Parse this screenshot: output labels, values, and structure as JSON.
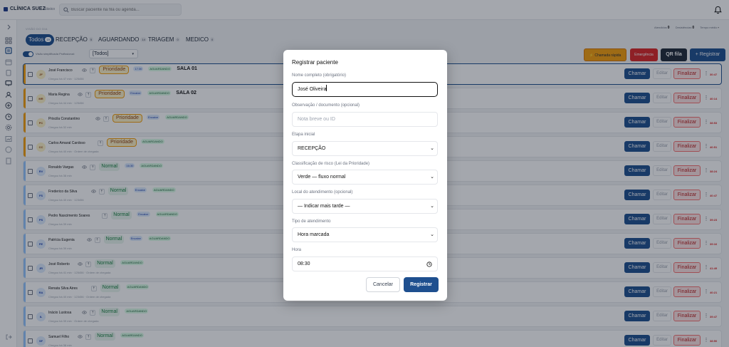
{
  "header": {
    "brand": "CLÍNICA SUEZ",
    "plan": "Básico",
    "search_placeholder": "Buscar paciente na fila ou agenda..."
  },
  "page": {
    "overline": "VISÃO DO DIA",
    "counters": [
      {
        "label": "Atendidos",
        "value": "0"
      },
      {
        "label": "Desistências",
        "value": "0"
      },
      {
        "label": "Tempo médio",
        "value": "-"
      }
    ],
    "tabs": [
      {
        "label": "Todos",
        "count": "19",
        "active": true
      },
      {
        "label": "RECEPÇÃO",
        "count": "5"
      },
      {
        "label": "AGUARDANDO",
        "count": "14"
      },
      {
        "label": "TRIAGEM",
        "count": "0"
      },
      {
        "label": "MEDICO",
        "count": "0"
      }
    ],
    "toggle_label": "Visão simplificada",
    "professional_label": "Profissional:",
    "professional_value": "[Todos]",
    "toolbar": {
      "chamada_rapida": "Chamada rápida",
      "emergencia": "Emergência",
      "qr_fila": "QR fila",
      "registrar": "+ Registrar"
    }
  },
  "queue": {
    "rows": [
      {
        "initials": "JF",
        "name": "José Francisco",
        "triage": "Prioridade",
        "time": "17:30",
        "status": "AGUARDANDO",
        "room": "SALA 01",
        "sub": "Chegou há 47 min · 125456",
        "timer": "30:47",
        "chamar": "Chamar",
        "editar": "Editar",
        "finalizar": "Finalizar"
      },
      {
        "initials": "MR",
        "name": "Maria Regina",
        "triage": "Prioridade",
        "time": "Encaixe",
        "status": "AGUARDANDO",
        "room": "SALA 02",
        "sub": "Chegou há 44 min · 125456",
        "timer": "40:14",
        "chamar": "Chamar",
        "editar": "Editar",
        "finalizar": "Finalizar"
      },
      {
        "initials": "PC",
        "name": "Priscila Constantino",
        "triage": "Prioridade",
        "time": "Encaixe",
        "status": "AGUARDANDO",
        "room": "",
        "sub": "Chegou há 32 min",
        "timer": "38:53",
        "chamar": "Chamar",
        "editar": "Editar",
        "finalizar": "Finalizar"
      },
      {
        "initials": "CC",
        "name": "Carlos Amaral Cardoso",
        "triage": "Prioridade",
        "time": "",
        "status": "AGUARDANDO",
        "room": "",
        "sub": "Chegou há 40 min · Ordem de chegada",
        "timer": "40:51",
        "chamar": "Chamar",
        "editar": "Editar",
        "finalizar": "Finalizar"
      },
      {
        "initials": "RV",
        "name": "Ronaldo Vargas",
        "triage": "Normal",
        "time": "16:30",
        "status": "AGUARDANDO",
        "room": "",
        "sub": "Chegou há 38 min",
        "timer": "38:24",
        "chamar": "Chamar",
        "editar": "Editar",
        "finalizar": "Finalizar"
      },
      {
        "initials": "FS",
        "name": "Frederico da Silva",
        "triage": "Normal",
        "time": "Encaixe",
        "status": "AGUARDANDO",
        "room": "",
        "sub": "Chegou há 40 min · 123456",
        "timer": "40:47",
        "chamar": "Chamar",
        "editar": "Editar",
        "finalizar": "Finalizar"
      },
      {
        "initials": "PS",
        "name": "Pedro Nascimento Soares",
        "triage": "Normal",
        "time": "Encaixe",
        "status": "AGUARDANDO",
        "room": "",
        "sub": "Chegou há 39 min",
        "timer": "39:23",
        "chamar": "Chamar",
        "editar": "Editar",
        "finalizar": "Finalizar"
      },
      {
        "initials": "PE",
        "name": "Patrícia Eugenia",
        "triage": "Normal",
        "time": "Encaixe",
        "status": "AGUARDANDO",
        "room": "",
        "sub": "Chegou há 39 min",
        "timer": "39:16",
        "chamar": "Chamar",
        "editar": "Editar",
        "finalizar": "Finalizar"
      },
      {
        "initials": "JR",
        "name": "José Roberto",
        "triage": "Normal",
        "time": "",
        "status": "AGUARDANDO",
        "room": "",
        "sub": "Chegou há 41 min · 125456 · Ordem de chegada",
        "timer": "41:49",
        "chamar": "Chamar",
        "editar": "Editar",
        "finalizar": "Finalizar"
      },
      {
        "initials": "RA",
        "name": "Renata Silva Aires",
        "triage": "Normal",
        "time": "",
        "status": "AGUARDANDO",
        "room": "",
        "sub": "Chegou há 40 min · 123456 · Ordem de chegada",
        "timer": "40:21",
        "chamar": "Chamar",
        "editar": "Editar",
        "finalizar": "Finalizar"
      },
      {
        "initials": "IL",
        "name": "Inácio Lustosa",
        "triage": "Normal",
        "time": "",
        "status": "AGUARDANDO",
        "room": "",
        "sub": "Chegou há 39 min · Ordem de chegada",
        "timer": "39:47",
        "chamar": "Chamar",
        "editar": "Editar",
        "finalizar": "Finalizar"
      },
      {
        "initials": "SF",
        "name": "Samuel Filho",
        "triage": "Normal",
        "time": "",
        "status": "AGUARDANDO",
        "room": "",
        "sub": "Chegou há 38 min",
        "timer": "38:50",
        "chamar": "Chamar",
        "editar": "Editar",
        "finalizar": "Finalizar"
      }
    ]
  },
  "modal": {
    "title": "Registrar paciente",
    "name_label": "Nome completo (obrigatório)",
    "name_value": "José Oliveira",
    "obs_label": "Observação / documento (opcional)",
    "obs_placeholder": "Nota breve ou ID",
    "stage_label": "Etapa inicial",
    "stage_value": "RECEPÇÃO",
    "risk_label": "Classificação de risco (Lei da Prioridade)",
    "risk_value": "Verde — fluxo normal",
    "location_label": "Local do atendimento (opcional)",
    "location_value": "— Indicar mais tarde —",
    "type_label": "Tipo de atendimento",
    "type_value": "Hora marcada",
    "time_label": "Hora",
    "time_value": "08:30",
    "cancel": "Cancelar",
    "submit": "Registrar"
  },
  "colors": {
    "primary": "#1e4f8f",
    "priority": "#f59e0b",
    "normal": "#15803d",
    "emergency": "#dc2626",
    "quick_call": "#f59e0b"
  }
}
